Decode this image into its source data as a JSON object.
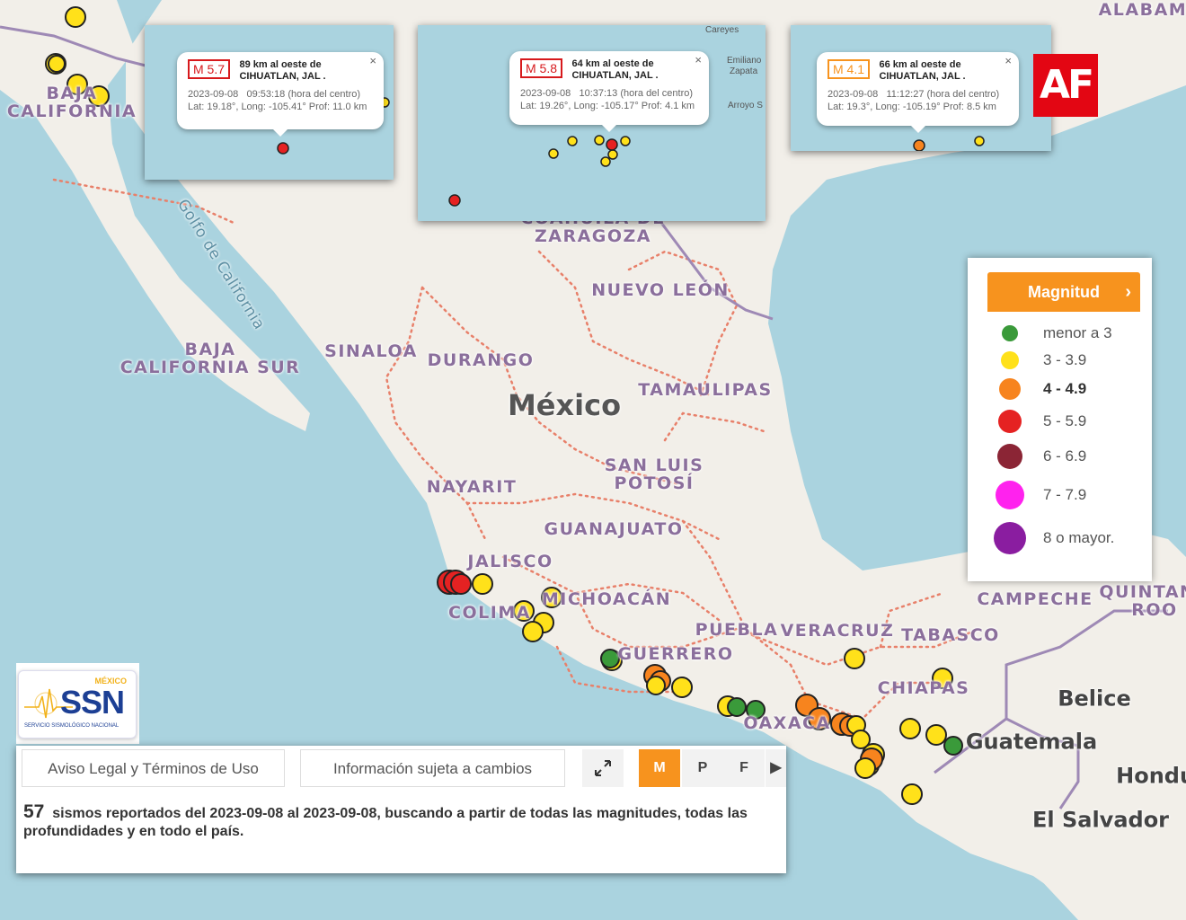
{
  "map": {
    "country_label": "México",
    "states": [
      "BAJA CALIFORNIA",
      "BAJA CALIFORNIA SUR",
      "SINALOA",
      "DURANGO",
      "COAHUILA DE ZARAGOZA",
      "NUEVO LEÓN",
      "TAMAULIPAS",
      "SAN LUIS POTOSÍ",
      "NAYARIT",
      "JALISCO",
      "GUANAJUATO",
      "COLIMA",
      "MICHOACÁN",
      "GUERRERO",
      "PUEBLA",
      "VERACRUZ",
      "OAXACA",
      "TABASCO",
      "CHIAPAS",
      "CAMPECHE",
      "QUINTANA ROO",
      "ALABAMA"
    ],
    "neighbors": [
      "Belice",
      "Guatemala",
      "Honduras",
      "El Salvador"
    ],
    "water": [
      "Golfo de California"
    ],
    "small_places": [
      "Careyes",
      "Emiliano Zapata",
      "Arroyo Seco"
    ],
    "colors": {
      "land": "#f2efe9",
      "water": "#aad3df",
      "state_border": "#e8806a",
      "country_border": "#9e89b5"
    }
  },
  "popups": [
    {
      "mag": "M 5.7",
      "color": "#d7191c",
      "place_line1": "89 km al oeste de",
      "place_line2": "CIHUATLAN, JAL .",
      "date": "2023-09-08",
      "time": "09:53:18 (hora del centro)",
      "coords": "Lat: 19.18°, Long: -105.41°  Prof: 11.0 km"
    },
    {
      "mag": "M 5.8",
      "color": "#d7191c",
      "place_line1": "64 km al oeste de",
      "place_line2": "CIHUATLAN, JAL .",
      "date": "2023-09-08",
      "time": "10:37:13 (hora del centro)",
      "coords": "Lat: 19.26°, Long: -105.17°  Prof: 4.1 km"
    },
    {
      "mag": "M 4.1",
      "color": "#f7931e",
      "place_line1": "66 km al oeste de",
      "place_line2": "CIHUATLAN, JAL .",
      "date": "2023-09-08",
      "time": "11:12:27 (hora del centro)",
      "coords": "Lat: 19.3°, Long: -105.19°  Prof: 8.5 km"
    }
  ],
  "popup_close": "×",
  "legend": {
    "title": "Magnitud",
    "chevron": "›",
    "items": [
      {
        "label": "menor a 3",
        "color": "#3a9a3a",
        "bold": false
      },
      {
        "label": "3 - 3.9",
        "color": "#ffe11a",
        "bold": false
      },
      {
        "label": "4 - 4.9",
        "color": "#f7841e",
        "bold": true
      },
      {
        "label": "5 - 5.9",
        "color": "#e52222",
        "bold": false
      },
      {
        "label": "6 - 6.9",
        "color": "#8b2535",
        "bold": false
      },
      {
        "label": "7 - 7.9",
        "color": "#ff22ee",
        "bold": false
      },
      {
        "label": "8 o mayor.",
        "color": "#8a1da0",
        "bold": false
      }
    ]
  },
  "ssn": {
    "country": "MÉXICO",
    "acronym": "SSN",
    "subtitle": "SERVICIO SISMOLÓGICO NACIONAL"
  },
  "panel": {
    "legal_button": "Aviso Legal y Términos de Uso",
    "info_button": "Información sujeta a cambios",
    "tools": [
      "M",
      "P",
      "F"
    ],
    "summary_count": "57",
    "summary_text": "sismos reportados del 2023-09-08 al 2023-09-08, buscando a partir de todas las magnitudes, todas las profundidades y en todo el país."
  },
  "watermark": "AF"
}
